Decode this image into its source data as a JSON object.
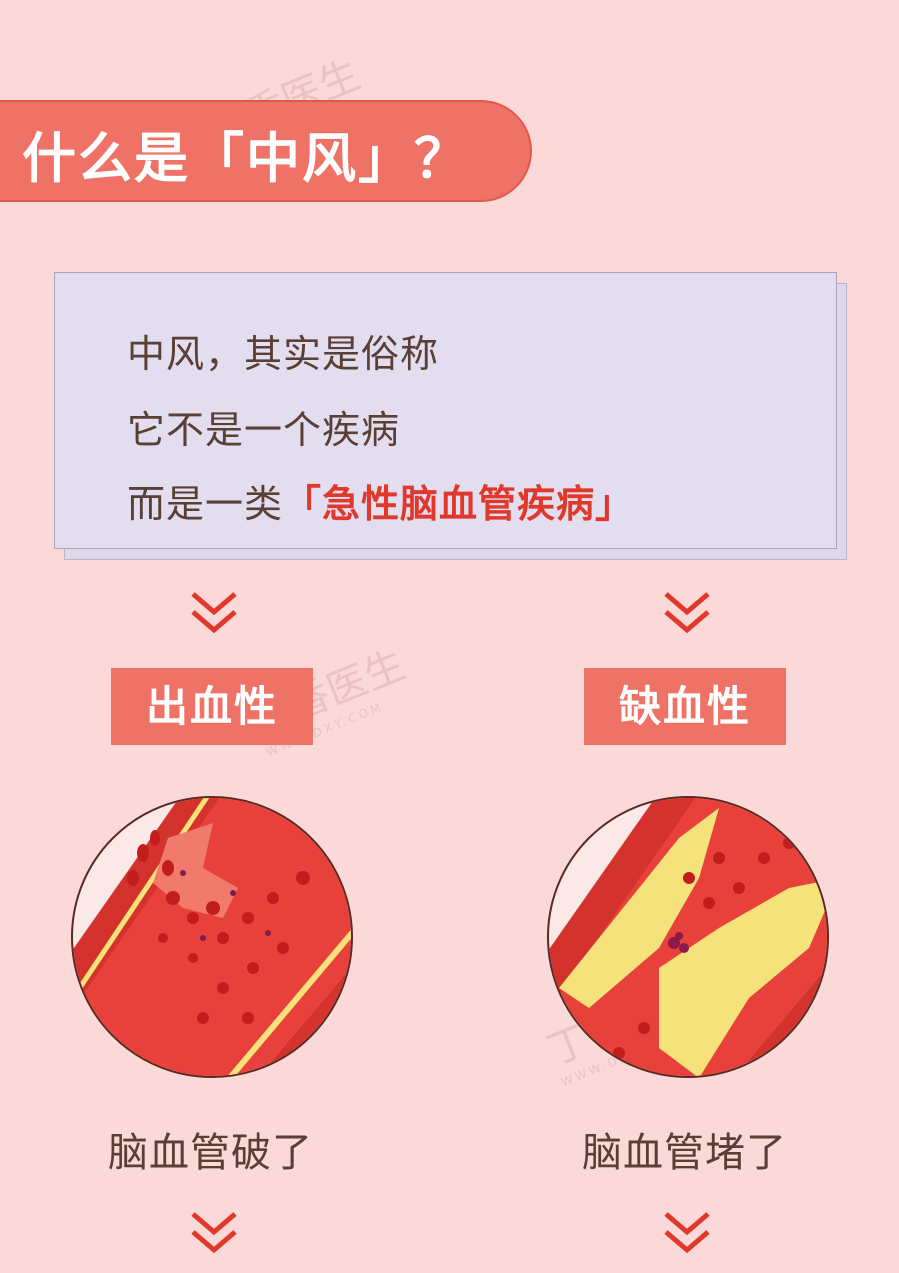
{
  "title": "什么是「中风」？",
  "info": {
    "line1": "中风，其实是俗称",
    "line2": "它不是一个疾病",
    "line3_prefix": "而是一类",
    "line3_highlight": "「急性脑血管疾病」"
  },
  "categories": [
    {
      "label": "出血性",
      "caption": "脑血管破了"
    },
    {
      "label": "缺血性",
      "caption": "脑血管堵了"
    }
  ],
  "watermark": {
    "text": "丁香医生",
    "sub": "WWW.DXY.COM"
  },
  "colors": {
    "background": "#fbd9d9",
    "accent": "#ef7266",
    "highlight": "#e0392b",
    "card": "#e2ddef",
    "text": "#5a3f35"
  },
  "icons": [
    "double-chevron-down-icon",
    "hemorrhagic-vessel-illustration",
    "ischemic-vessel-illustration"
  ]
}
